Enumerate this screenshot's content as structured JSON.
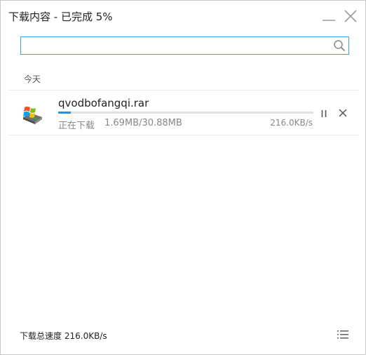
{
  "window": {
    "title": "下载内容",
    "title_separator": " - ",
    "title_status": "已完成 5%"
  },
  "search": {
    "value": "",
    "placeholder": ""
  },
  "sections": [
    {
      "label": "今天",
      "items": [
        {
          "filename": "qvodbofangqi.rar",
          "status": "正在下载",
          "size": "1.69MB/30.88MB",
          "speed": "216.0KB/s",
          "progress": 0.05
        }
      ]
    }
  ],
  "footer": {
    "speed_label": "下载总速度",
    "speed_value": "216.0KB/s"
  },
  "colors": {
    "accent": "#2b8fe0",
    "search_border": "#3aa3e3"
  },
  "icons": {
    "minimize": "minimize-icon",
    "close": "close-icon",
    "search": "search-icon",
    "file": "archive-file-icon",
    "pause": "pause-icon",
    "cancel": "cancel-icon",
    "menu": "list-menu-icon"
  }
}
